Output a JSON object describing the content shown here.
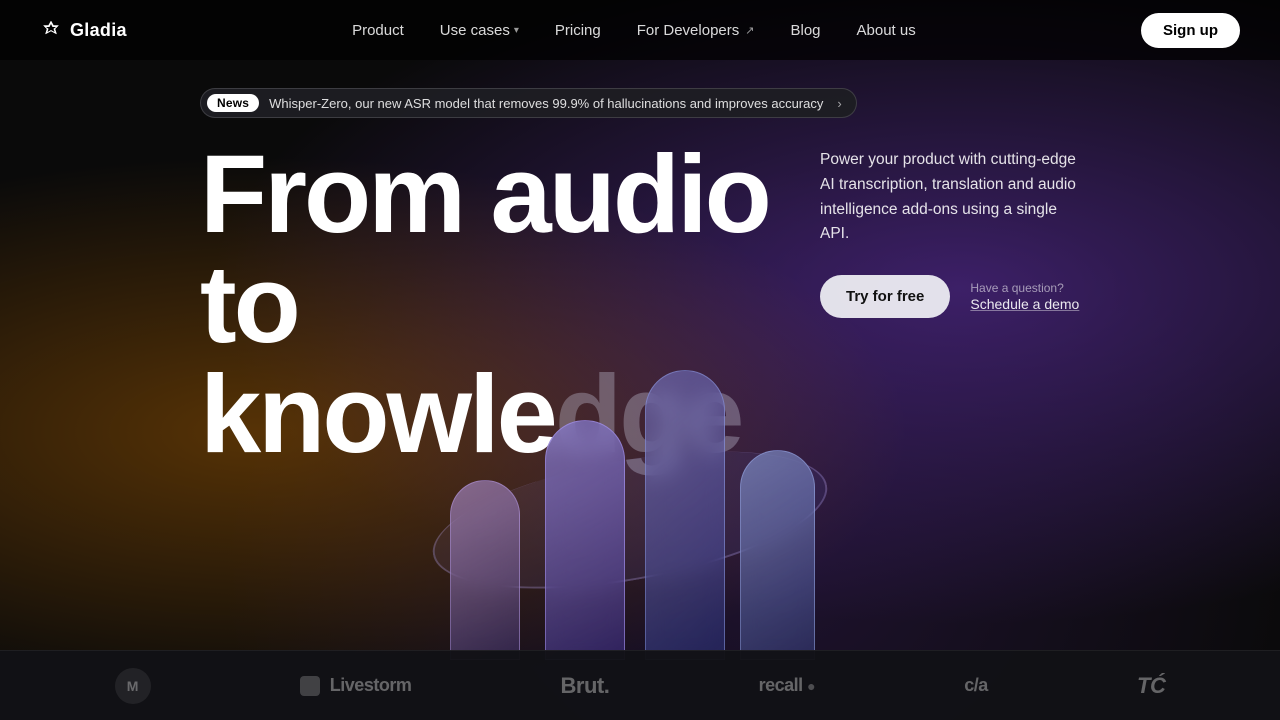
{
  "nav": {
    "logo_text": "Gladia",
    "links": [
      {
        "label": "Product",
        "has_dropdown": false,
        "is_external": false
      },
      {
        "label": "Use cases",
        "has_dropdown": true,
        "is_external": false
      },
      {
        "label": "Pricing",
        "has_dropdown": false,
        "is_external": false
      },
      {
        "label": "For Developers",
        "has_dropdown": false,
        "is_external": true
      },
      {
        "label": "Blog",
        "has_dropdown": false,
        "is_external": false
      },
      {
        "label": "About us",
        "has_dropdown": false,
        "is_external": false
      }
    ],
    "signup_label": "Sign up"
  },
  "news": {
    "tag": "News",
    "text": "Whisper-Zero, our new ASR model that removes 99.9% of hallucinations and improves accuracy",
    "arrow": "›"
  },
  "hero": {
    "headline_line1": "From audio to",
    "headline_line2_bright": "knowle",
    "headline_line2_faded": "dge",
    "description": "Power your product with cutting-edge AI transcription, translation and audio intelligence add-ons using a single API.",
    "try_btn": "Try for free",
    "demo_question": "Have a question?",
    "demo_link": "Schedule a demo"
  },
  "logos": [
    {
      "text": "M",
      "label": "Murf",
      "type": "circle"
    },
    {
      "text": "Livestorm",
      "label": "Livestorm",
      "type": "text_with_icon"
    },
    {
      "text": "Brut.",
      "label": "Brut",
      "type": "text"
    },
    {
      "text": "recall ●",
      "label": "Recall",
      "type": "text"
    },
    {
      "text": "c/a",
      "label": "ContentAI",
      "type": "text"
    },
    {
      "text": "TČ",
      "label": "TechCrunch",
      "type": "text"
    }
  ]
}
